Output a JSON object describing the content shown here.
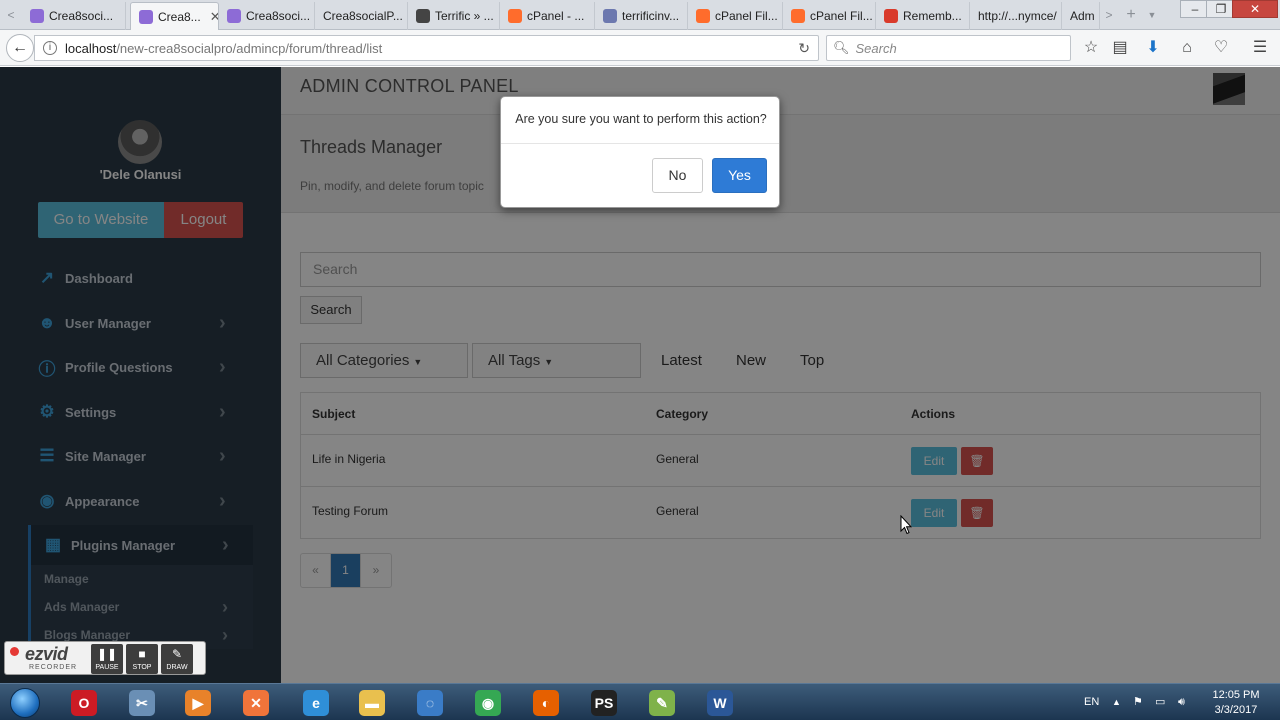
{
  "browser": {
    "tabs": [
      {
        "title": "Crea8soci...",
        "favicon": "feather-icon",
        "color": "#8d6bd6",
        "active": false
      },
      {
        "title": "Crea8...",
        "favicon": "feather-icon",
        "color": "#8d6bd6",
        "active": true
      },
      {
        "title": "Crea8soci...",
        "favicon": "feather-icon",
        "color": "#8d6bd6",
        "active": false
      },
      {
        "title": "Crea8socialP...",
        "favicon": "none",
        "color": "#cccccc",
        "active": false
      },
      {
        "title": "Terrific » ...",
        "favicon": "t-icon",
        "color": "#444444",
        "active": false
      },
      {
        "title": "cPanel - ...",
        "favicon": "cpanel-icon",
        "color": "#ff6c2c",
        "active": false
      },
      {
        "title": "terrificinv...",
        "favicon": "pma-icon",
        "color": "#6c78af",
        "active": false
      },
      {
        "title": "cPanel Fil...",
        "favicon": "cpanel-icon",
        "color": "#ff6c2c",
        "active": false
      },
      {
        "title": "cPanel Fil...",
        "favicon": "cpanel-icon",
        "color": "#ff6c2c",
        "active": false
      },
      {
        "title": "Rememb...",
        "favicon": "gear-icon",
        "color": "#d93a2b",
        "active": false
      },
      {
        "title": "http://...nymce/",
        "favicon": "none",
        "color": "#cccccc",
        "active": false
      },
      {
        "title": "Adm",
        "favicon": "none",
        "color": "#cccccc",
        "active": false
      }
    ],
    "url_host": "localhost",
    "url_path": "/new-crea8socialpro/admincp/forum/thread/list",
    "search_placeholder": "Search"
  },
  "sidebar": {
    "user_name": "'Dele Olanusi",
    "go_website": "Go to Website",
    "logout": "Logout",
    "menu": [
      {
        "label": "Dashboard",
        "icon": "chart-line-icon",
        "glyph": "↗",
        "chevron": false
      },
      {
        "label": "User Manager",
        "icon": "users-icon",
        "glyph": "☻",
        "chevron": true
      },
      {
        "label": "Profile Questions",
        "icon": "info-circle-icon",
        "glyph": "ⓘ",
        "chevron": true
      },
      {
        "label": "Settings",
        "icon": "gear-icon",
        "glyph": "⚙",
        "chevron": true
      },
      {
        "label": "Site Manager",
        "icon": "sliders-icon",
        "glyph": "☰",
        "chevron": true
      },
      {
        "label": "Appearance",
        "icon": "palette-icon",
        "glyph": "◉",
        "chevron": true
      },
      {
        "label": "Plugins Manager",
        "icon": "map-icon",
        "glyph": "▦",
        "chevron": true,
        "active": true
      }
    ],
    "submenu": [
      "Manage",
      "Ads Manager",
      "Blogs Manager"
    ]
  },
  "main": {
    "panel_title": "ADMIN CONTROL PANEL",
    "page_title": "Threads Manager",
    "page_subtitle": "Pin, modify, and delete forum topic",
    "search_placeholder": "Search",
    "search_button": "Search",
    "filters": {
      "categories": "All Categories",
      "tags": "All Tags"
    },
    "sort_links": [
      "Latest",
      "New",
      "Top"
    ],
    "table": {
      "headers": [
        "Subject",
        "Category",
        "Actions"
      ],
      "rows": [
        {
          "subject": "Life in Nigeria",
          "category": "General",
          "edit": "Edit"
        },
        {
          "subject": "Testing Forum",
          "category": "General",
          "edit": "Edit"
        }
      ]
    },
    "pagination": {
      "prev": "«",
      "current": "1",
      "next": "»"
    }
  },
  "modal": {
    "message": "Are you sure you want to perform this action?",
    "no": "No",
    "yes": "Yes"
  },
  "recorder": {
    "brand": "ezvid",
    "subtitle": "RECORDER",
    "buttons": [
      "PAUSE",
      "STOP",
      "DRAW"
    ]
  },
  "taskbar": {
    "language": "EN",
    "time": "12:05 PM",
    "date": "3/3/2017",
    "apps": [
      {
        "name": "opera-icon",
        "glyph": "O",
        "color": "#cc1b24"
      },
      {
        "name": "sniping-tool-icon",
        "glyph": "✂",
        "color": "#6a8fb5"
      },
      {
        "name": "media-player-icon",
        "glyph": "▶",
        "color": "#e8822a"
      },
      {
        "name": "xampp-icon",
        "glyph": "✕",
        "color": "#f0743a"
      },
      {
        "name": "internet-explorer-icon",
        "glyph": "e",
        "color": "#2f8fd8"
      },
      {
        "name": "file-explorer-icon",
        "glyph": "▬",
        "color": "#e9c04e"
      },
      {
        "name": "chat-app-icon",
        "glyph": "◌",
        "color": "#3a7cc7"
      },
      {
        "name": "chrome-icon",
        "glyph": "◉",
        "color": "#35a853"
      },
      {
        "name": "firefox-icon",
        "glyph": "◐",
        "color": "#e66000"
      },
      {
        "name": "phpstorm-icon",
        "glyph": "PS",
        "color": "#222222"
      },
      {
        "name": "notepad-icon",
        "glyph": "✎",
        "color": "#7fb24a"
      },
      {
        "name": "word-icon",
        "glyph": "W",
        "color": "#2b5797"
      }
    ]
  }
}
